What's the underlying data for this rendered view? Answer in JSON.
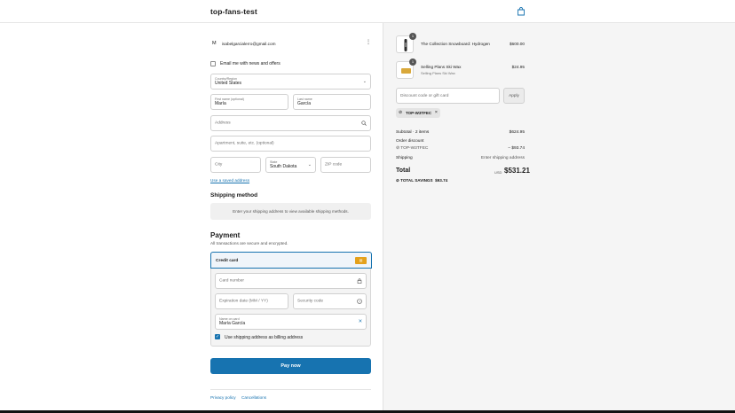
{
  "header": {
    "store_name": "top-fans-test"
  },
  "account": {
    "initial": "M",
    "email": "isabelgarcialerro@gmail.com"
  },
  "marketing": {
    "label": "Email me with news and offers",
    "checked": false
  },
  "address": {
    "country_label": "Country/Region",
    "country_value": "United States",
    "first_name_label": "First name (optional)",
    "first_name_value": "María",
    "last_name_label": "Last name",
    "last_name_value": "García",
    "address_placeholder": "Address",
    "apartment_placeholder": "Apartment, suite, etc. (optional)",
    "city_placeholder": "City",
    "state_label": "State",
    "state_value": "South Dakota",
    "zip_placeholder": "ZIP code",
    "saved_address_link": "Use a saved address"
  },
  "shipping_method": {
    "heading": "Shipping method",
    "message": "Enter your shipping address to view available shipping methods."
  },
  "payment": {
    "heading": "Payment",
    "subtitle": "All transactions are secure and encrypted.",
    "method_label": "Credit card",
    "card_number_placeholder": "Card number",
    "expiry_placeholder": "Expiration date (MM / YY)",
    "security_placeholder": "Security code",
    "name_on_card_label": "Name on card",
    "name_on_card_value": "María García",
    "billing_same_label": "Use shipping address as billing address",
    "billing_same_checked": true
  },
  "pay_button": "Pay now",
  "footer": {
    "privacy": "Privacy policy",
    "cancellations": "Cancellations"
  },
  "order": {
    "items": [
      {
        "name": "The Collection Snowboard: Hydrogen",
        "variant": "",
        "qty": "1",
        "price": "$600.00"
      },
      {
        "name": "Selling Plans Ski Wax",
        "variant": "Selling Plans Ski Wax",
        "qty": "1",
        "price": "$24.95"
      }
    ],
    "discount_placeholder": "Discount code or gift card",
    "apply_label": "Apply",
    "applied_code": "TOP-W3TFEC",
    "subtotal_label": "Subtotal · 2 items",
    "subtotal_value": "$624.95",
    "order_discount_label": "Order discount",
    "order_discount_code": "TOP-W3TFEC",
    "order_discount_value": "− $93.74",
    "shipping_label": "Shipping",
    "shipping_value": "Enter shipping address",
    "total_label": "Total",
    "total_currency": "USD",
    "total_value": "$531.21",
    "savings_label": "TOTAL SAVINGS",
    "savings_value": "$93.74"
  },
  "colors": {
    "accent": "#1773b0",
    "sidebar_bg": "#f5f5f5"
  }
}
